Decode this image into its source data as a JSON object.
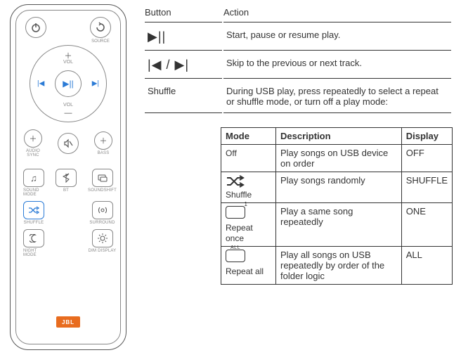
{
  "table1": {
    "headers": {
      "button": "Button",
      "action": "Action"
    },
    "rows": [
      {
        "button_sym": "▶||",
        "action": "Start, pause or resume play."
      },
      {
        "button_sym": "|◀ / ▶|",
        "action": "Skip to the previous or next track."
      },
      {
        "button_sym": "Shuffle",
        "action": "During USB play, press repeatedly to select a repeat or shuffle mode, or turn off a play mode:"
      }
    ]
  },
  "mode_table": {
    "headers": {
      "mode": "Mode",
      "desc": "Description",
      "disp": "Display"
    },
    "rows": [
      {
        "mode_label": "Off",
        "desc": "Play songs on USB device on order",
        "disp": "OFF"
      },
      {
        "mode_label": "Shuffle",
        "desc": "Play songs randomly",
        "disp": "SHUFFLE"
      },
      {
        "mode_label": "Repeat once",
        "desc": "Play a same song repeatedly",
        "disp": "ONE"
      },
      {
        "mode_label": "Repeat all",
        "desc": "Play all songs on USB repeatedly by order of the folder logic",
        "disp": "ALL"
      }
    ]
  },
  "remote": {
    "source": "SOURCE",
    "vol": "VOL",
    "audio_sync": "AUDIO\nSYNC",
    "bass": "BASS",
    "labels": {
      "sound_mode": "SOUND MODE",
      "bt": "BT",
      "soundshift": "SOUNDSHIFT",
      "shuffle": "SHUFFLE",
      "surround": "SURROUND",
      "night_mode": "NIGHT MODE",
      "dim_display": "DIM DISPLAY"
    },
    "logo": "JBL",
    "repeat_once_sup": "1",
    "repeat_all_sup": "ALL"
  }
}
